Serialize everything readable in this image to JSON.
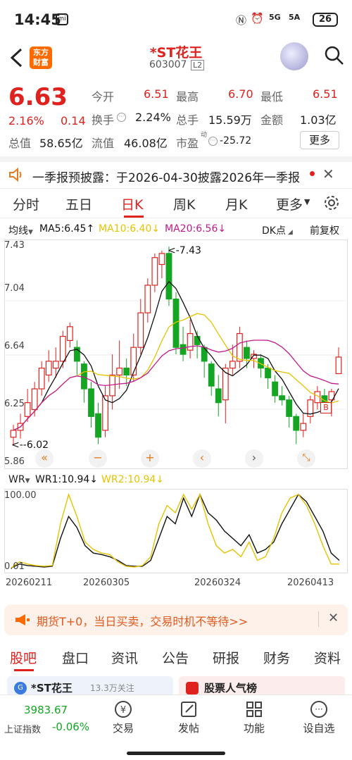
{
  "status_bar": {
    "time": "14:45",
    "signal1": "5G",
    "signal2": "5A",
    "battery": "26"
  },
  "header": {
    "logo_text": "东方\n财富",
    "stock_name": "*ST花王",
    "stock_code": "603007",
    "market_badge": "L2"
  },
  "quote": {
    "price": "6.63",
    "change_pct": "2.16%",
    "change_amt": "0.14",
    "open_label": "今开",
    "open": "6.51",
    "high_label": "最高",
    "high": "6.70",
    "low_label": "最低",
    "low": "6.51",
    "turnover_label": "换手",
    "turnover": "2.24%",
    "volume_label": "总手",
    "volume": "15.59万",
    "amount_label": "金额",
    "amount": "1.03亿",
    "mktcap_label": "总值",
    "mktcap": "58.65亿",
    "float_label": "流值",
    "float": "46.08亿",
    "pe_label": "市盈",
    "pe_sup": "动",
    "pe": "-25.72",
    "more_label": "更多"
  },
  "notice": {
    "text": "一季报预披露：于2026-04-30披露2026年一季报"
  },
  "tabs": [
    {
      "label": "分时"
    },
    {
      "label": "五日"
    },
    {
      "label": "日K"
    },
    {
      "label": "周K"
    },
    {
      "label": "月K"
    },
    {
      "label": "更多"
    }
  ],
  "kline_bar": {
    "indicator": "均线",
    "ma5": "MA5:6.45↑",
    "ma10": "MA10:6.40↓",
    "ma20": "MA20:6.56↓",
    "dk_label": "DK点",
    "adjust": "前复权"
  },
  "chart_labels": {
    "y_ticks": [
      "7.43",
      "7.04",
      "6.64",
      "6.25",
      "5.86"
    ],
    "max_marker": "<-7.43",
    "min_marker": "<--6.02",
    "b_marker": "B"
  },
  "chart_controls": [
    "«",
    "−",
    "+",
    "‹",
    "›",
    "⤡"
  ],
  "wr_bar": {
    "indicator": "WR",
    "wr1": "WR1:10.94↓",
    "wr2": "WR2:10.94↓"
  },
  "wr_chart": {
    "y_ticks": [
      "100.00",
      "0.01"
    ]
  },
  "dates": [
    "20260211",
    "20260305",
    "20260324",
    "20260413"
  ],
  "chart_data": [
    {
      "type": "candlestick",
      "ylim": [
        5.86,
        7.43
      ],
      "candles": [
        [
          6.05,
          6.1,
          6.0,
          6.14
        ],
        [
          6.1,
          6.15,
          6.04,
          6.22
        ],
        [
          6.2,
          6.3,
          6.16,
          6.4
        ],
        [
          6.25,
          6.4,
          6.2,
          6.45
        ],
        [
          6.4,
          6.55,
          6.35,
          6.6
        ],
        [
          6.5,
          6.6,
          6.45,
          6.68
        ],
        [
          6.55,
          6.6,
          6.48,
          6.7
        ],
        [
          6.6,
          6.78,
          6.55,
          6.82
        ],
        [
          6.75,
          6.85,
          6.7,
          6.88
        ],
        [
          6.7,
          6.6,
          6.5,
          6.75
        ],
        [
          6.58,
          6.4,
          6.3,
          6.6
        ],
        [
          6.4,
          6.2,
          6.12,
          6.45
        ],
        [
          6.22,
          6.05,
          6.0,
          6.3
        ],
        [
          6.1,
          6.35,
          6.05,
          6.42
        ],
        [
          6.35,
          6.5,
          6.25,
          6.65
        ],
        [
          6.5,
          6.55,
          6.4,
          6.75
        ],
        [
          6.55,
          6.5,
          6.42,
          6.62
        ],
        [
          6.5,
          6.7,
          6.45,
          6.8
        ],
        [
          6.7,
          6.95,
          6.65,
          7.05
        ],
        [
          6.95,
          7.15,
          6.88,
          7.2
        ],
        [
          7.15,
          7.35,
          7.1,
          7.38
        ],
        [
          7.3,
          7.38,
          7.2,
          7.4
        ],
        [
          7.38,
          7.05,
          7.0,
          7.43
        ],
        [
          7.05,
          6.7,
          6.65,
          7.1
        ],
        [
          6.72,
          6.65,
          6.6,
          6.85
        ],
        [
          6.68,
          6.8,
          6.62,
          6.9
        ],
        [
          6.78,
          6.72,
          6.62,
          6.82
        ],
        [
          6.7,
          6.6,
          6.48,
          6.72
        ],
        [
          6.58,
          6.42,
          6.35,
          6.6
        ],
        [
          6.4,
          6.3,
          6.2,
          6.5
        ],
        [
          6.32,
          6.55,
          6.15,
          6.58
        ],
        [
          6.55,
          6.6,
          6.5,
          6.72
        ],
        [
          6.6,
          6.8,
          6.55,
          6.85
        ],
        [
          6.7,
          6.62,
          6.55,
          6.75
        ],
        [
          6.62,
          6.65,
          6.55,
          6.68
        ],
        [
          6.62,
          6.55,
          6.48,
          6.65
        ],
        [
          6.55,
          6.48,
          6.4,
          6.58
        ],
        [
          6.45,
          6.35,
          6.3,
          6.5
        ],
        [
          6.35,
          6.32,
          6.28,
          6.42
        ],
        [
          6.32,
          6.2,
          6.12,
          6.35
        ],
        [
          6.2,
          6.1,
          6.0,
          6.22
        ],
        [
          6.1,
          6.15,
          6.05,
          6.22
        ],
        [
          6.2,
          6.32,
          6.15,
          6.35
        ],
        [
          6.3,
          6.38,
          6.25,
          6.42
        ],
        [
          6.35,
          6.3,
          6.25,
          6.4
        ],
        [
          6.32,
          6.38,
          6.2,
          6.4
        ],
        [
          6.51,
          6.63,
          6.51,
          6.7
        ]
      ],
      "ma_series": [
        {
          "name": "MA5",
          "color": "#111111"
        },
        {
          "name": "MA10",
          "color": "#e6c300"
        },
        {
          "name": "MA20",
          "color": "#c21a8c"
        }
      ]
    },
    {
      "type": "line",
      "ylim": [
        0,
        100
      ],
      "series": [
        {
          "name": "WR1",
          "color": "#111111",
          "values": [
            0,
            5,
            3,
            2,
            1,
            2,
            40,
            70,
            55,
            30,
            20,
            18,
            15,
            10,
            3,
            2,
            2,
            10,
            40,
            70,
            60,
            95,
            70,
            100,
            75,
            65,
            50,
            40,
            30,
            45,
            20,
            25,
            35,
            60,
            80,
            100,
            90,
            70,
            50,
            20,
            10
          ]
        },
        {
          "name": "WR2",
          "color": "#e6c300",
          "values": [
            0,
            8,
            5,
            3,
            2,
            3,
            60,
            100,
            70,
            35,
            25,
            20,
            18,
            8,
            2,
            1,
            3,
            15,
            60,
            85,
            75,
            100,
            80,
            100,
            60,
            30,
            20,
            25,
            15,
            35,
            10,
            15,
            40,
            75,
            95,
            100,
            85,
            60,
            30,
            5,
            5
          ]
        }
      ]
    }
  ],
  "banner": {
    "text": "期货T+0，当日买卖，交易时机不等待>>"
  },
  "bottom_tabs": [
    {
      "label": "股吧"
    },
    {
      "label": "盘口"
    },
    {
      "label": "资讯"
    },
    {
      "label": "公告"
    },
    {
      "label": "研报"
    },
    {
      "label": "财务"
    },
    {
      "label": "资料"
    }
  ],
  "peek": {
    "card1": "*ST花王",
    "card1_sub": "13.3万关注",
    "card2": "股票人气榜"
  },
  "bottom_nav": {
    "index_value": "3983.67",
    "index_label": "上证指数",
    "index_change": "-0.06%",
    "items": [
      {
        "label": "交易"
      },
      {
        "label": "发帖"
      },
      {
        "label": "功能"
      },
      {
        "label": "设自选"
      }
    ]
  },
  "colors": {
    "up": "#e0221f",
    "down": "#14a523",
    "accent": "#ff6a00"
  }
}
